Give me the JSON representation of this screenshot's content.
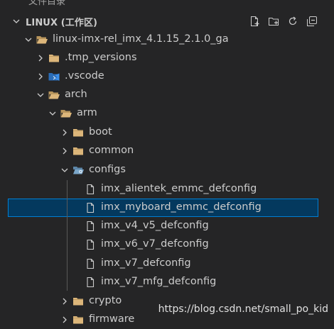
{
  "top_partial_text": "文件目录",
  "section": {
    "title": "LINUX (工作区)",
    "actions": [
      {
        "name": "new-file-icon"
      },
      {
        "name": "new-folder-icon"
      },
      {
        "name": "refresh-icon"
      },
      {
        "name": "collapse-all-icon"
      }
    ]
  },
  "tree": [
    {
      "label": "linux-imx-rel_imx_4.1.15_2.1.0_ga",
      "type": "folder-open",
      "expanded": true
    },
    {
      "label": ".tmp_versions",
      "type": "folder"
    },
    {
      "label": ".vscode",
      "type": "vscode-folder"
    },
    {
      "label": "arch",
      "type": "folder-open",
      "expanded": true
    },
    {
      "label": "arm",
      "type": "folder-open",
      "expanded": true
    },
    {
      "label": "boot",
      "type": "folder"
    },
    {
      "label": "common",
      "type": "folder"
    },
    {
      "label": "configs",
      "type": "config-folder-open",
      "expanded": true
    },
    {
      "label": "imx_alientek_emmc_defconfig",
      "type": "file"
    },
    {
      "label": "imx_myboard_emmc_defconfig",
      "type": "file",
      "selected": true
    },
    {
      "label": "imx_v4_v5_defconfig",
      "type": "file"
    },
    {
      "label": "imx_v6_v7_defconfig",
      "type": "file"
    },
    {
      "label": "imx_v7_defconfig",
      "type": "file"
    },
    {
      "label": "imx_v7_mfg_defconfig",
      "type": "file"
    },
    {
      "label": "crypto",
      "type": "folder"
    },
    {
      "label": "firmware",
      "type": "folder"
    }
  ],
  "watermark": "https://blog.csdn.net/small_po_kid",
  "colors": {
    "background": "#252526",
    "selection_background": "#04395e",
    "selection_border": "#007fd4",
    "folder": "#dcb67a",
    "vscode_folder": "#3b8eea",
    "config_folder": "#7aa6c9"
  }
}
